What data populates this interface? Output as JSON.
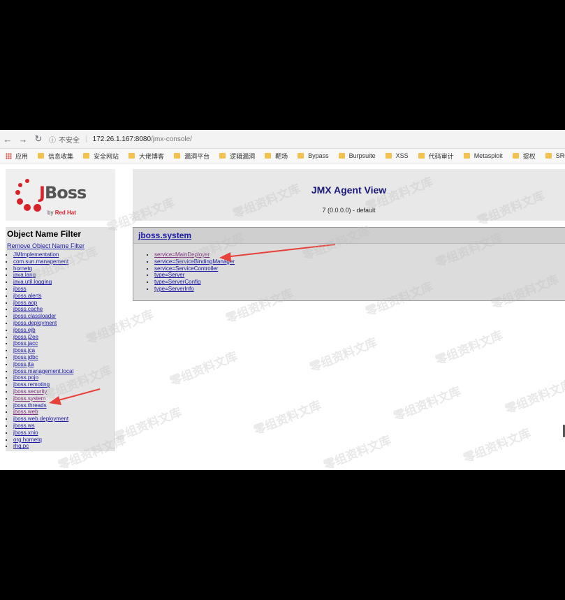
{
  "browser": {
    "insecure_label": "不安全",
    "url_host": "172.26.1.167:8080",
    "url_path": "/jmx-console/",
    "apps_label": "应用",
    "bookmarks": [
      "信息收集",
      "安全网站",
      "大佬博客",
      "漏洞平台",
      "逻辑漏洞",
      "靶场",
      "Bypass",
      "Burpsuite",
      "XSS",
      "代码审计",
      "Metasploit",
      "提权",
      "SRC"
    ]
  },
  "logo": {
    "brand_j": "J",
    "brand_rest": "Boss",
    "by": "by",
    "vendor": "Red Hat"
  },
  "header": {
    "title": "JMX Agent View",
    "subtitle": "7 (0.0.0.0) - default"
  },
  "sidebar": {
    "title": "Object Name Filter",
    "remove_link": "Remove Object Name Filter",
    "domains": [
      "JMImplementation",
      "com.sun.management",
      "hornetq",
      "java.lang",
      "java.util.logging",
      "jboss",
      "jboss.alerts",
      "jboss.aop",
      "jboss.cache",
      "jboss.classloader",
      "jboss.deployment",
      "jboss.ejb",
      "jboss.j2ee",
      "jboss.jacc",
      "jboss.jca",
      "jboss.jdbc",
      "jboss.jta",
      "jboss.management.local",
      "jboss.pojo",
      "jboss.remoting",
      "jboss.security",
      "jboss.system",
      "jboss.threads",
      "jboss.web",
      "jboss.web.deployment",
      "jboss.ws",
      "jboss.xnio",
      "org.hornetq",
      "rhq.pc"
    ]
  },
  "content": {
    "domain_title": "jboss.system",
    "mbeans": [
      "service=MainDeployer",
      "service=ServiceBindingManager",
      "service=ServiceController",
      "type=Server",
      "type=ServerConfig",
      "type=ServerInfo"
    ]
  },
  "watermark_text": "零组资料文库",
  "colors": {
    "link": "#1a1aa6",
    "visited_link": "#7b2c7b",
    "jboss_red": "#d8232a",
    "annotation_arrow": "#e8403a"
  }
}
